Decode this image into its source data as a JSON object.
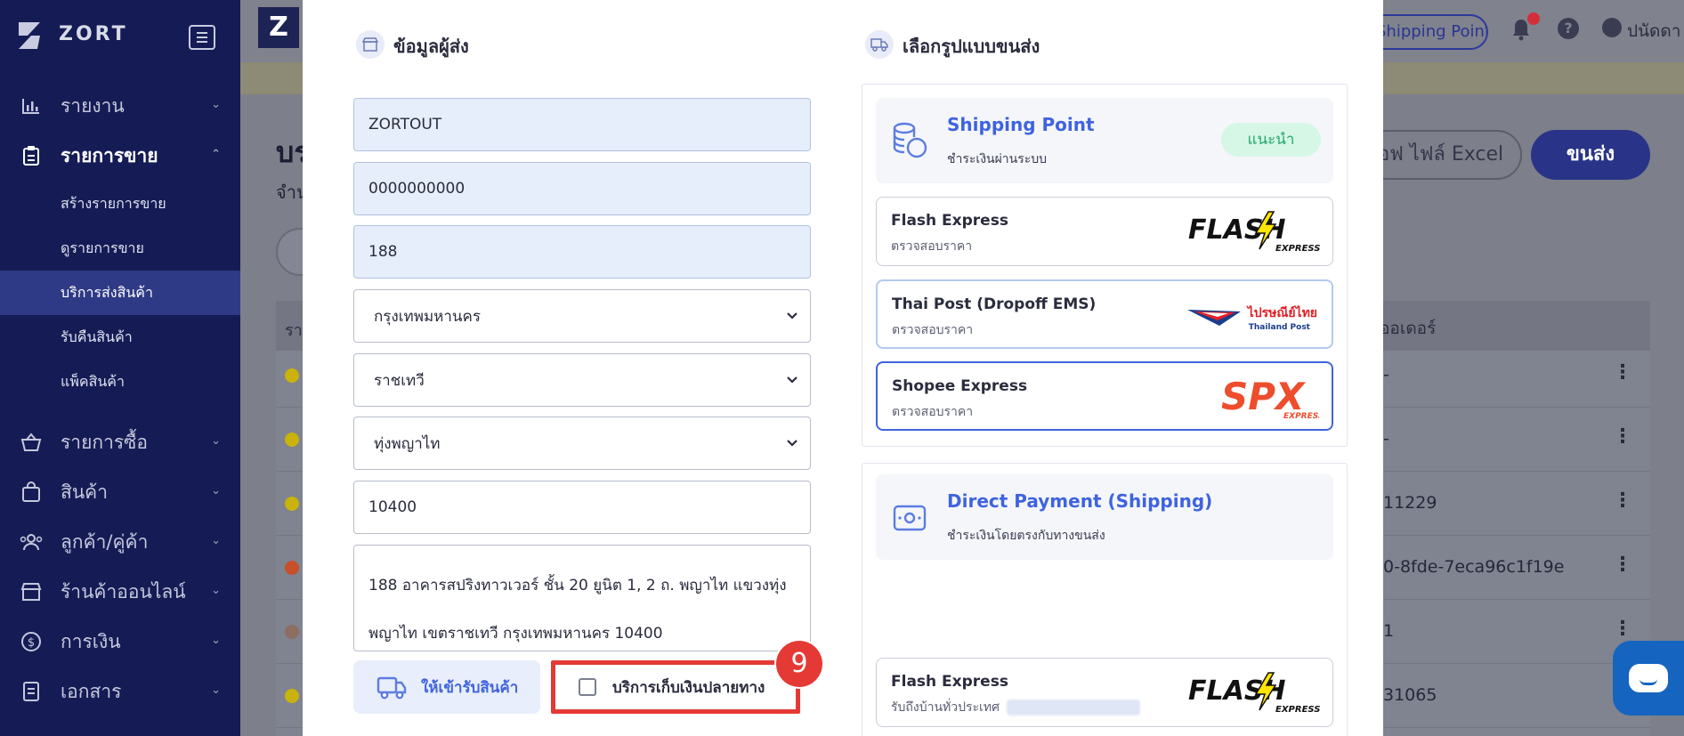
{
  "sidebar": {
    "brand": "ZORT",
    "items": [
      {
        "label": "รายงาน"
      },
      {
        "label": "รายการขาย"
      },
      {
        "label": "รายการซื้อ"
      },
      {
        "label": "สินค้า"
      },
      {
        "label": "ลูกค้า/คู่ค้า"
      },
      {
        "label": "ร้านค้าออนไลน์"
      },
      {
        "label": "การเงิน"
      },
      {
        "label": "เอกสาร"
      }
    ],
    "sales_sub": [
      {
        "label": "สร้างรายการขาย"
      },
      {
        "label": "ดูรายการขาย"
      },
      {
        "label": "บริการส่งสินค้า"
      },
      {
        "label": "รับคืนสินค้า"
      },
      {
        "label": "แพ็คสินค้า"
      }
    ]
  },
  "header": {
    "logo_letter": "Z",
    "shipping_point_pill": "Shipping Point",
    "user_name": "ปนัดดา"
  },
  "background_page": {
    "title": "บร",
    "subtitle": "จำน",
    "export_button": "อฟ ไฟล์ Excel",
    "ship_button": "ขนส่ง",
    "table_header_left": "รา",
    "table_header_right": "ออเดอร์",
    "rows": [
      {
        "value": "-",
        "dot_color": "#c9b30a"
      },
      {
        "value": "-",
        "dot_color": "#c9b30a"
      },
      {
        "value": "11229",
        "dot_color": "#c9b30a"
      },
      {
        "value": "0-8fde-7eca96c1f19e",
        "dot_color": "#c7502a"
      },
      {
        "value": "1",
        "dot_color": "#8d6e63"
      },
      {
        "value": "31065",
        "dot_color": "#c9b30a"
      }
    ]
  },
  "sender": {
    "section_title": "ข้อมูลผู้ส่ง",
    "name": "ZORTOUT",
    "phone": "0000000000",
    "house_no": "188",
    "province": "กรุงเทพมหานคร",
    "district": "ราชเทวี",
    "subdistrict": "ทุ่งพญาไท",
    "postcode": "10400",
    "address_line1": "188 อาคารสปริงทาวเวอร์ ชั้น 20 ยูนิต 1, 2 ถ. พญาไท แขวงทุ่ง",
    "address_line2": "พญาไท เขตราชเทวี กรุงเทพมหานคร 10400",
    "pickup_button": "ให้เข้ารับสินค้า",
    "cod_label": "บริการเก็บเงินปลายทาง",
    "step_number": "9"
  },
  "shipping": {
    "section_title": "เลือกรูปแบบขนส่ง",
    "shipping_point": {
      "title": "Shipping Point",
      "desc": "ชำระเงินผ่านระบบ",
      "badge": "แนะนำ",
      "carriers": [
        {
          "name": "Flash Express",
          "sub": "ตรวจสอบราคา",
          "logo": "flash-express-logo"
        },
        {
          "name": "Thai Post (Dropoff EMS)",
          "sub": "ตรวจสอบราคา",
          "logo": "thailand-post-logo",
          "logo_text": "ไปรษณีย์ไทย",
          "logo_sub": "Thailand Post"
        },
        {
          "name": "Shopee Express",
          "sub": "ตรวจสอบราคา",
          "logo": "spx-express-logo"
        }
      ]
    },
    "direct_payment": {
      "title": "Direct Payment (Shipping)",
      "desc": "ชำระเงินโดยตรงกับทางขนส่ง",
      "carriers": [
        {
          "name": "Flash Express",
          "sub": "รับถึงบ้านทั่วประเทศ",
          "logo": "flash-express-logo"
        }
      ]
    },
    "logo_text": {
      "flash": "FLASH",
      "flash_sub": "EXPRESS",
      "spx": "SPX",
      "spx_sub": "EXPRESS"
    }
  },
  "colors": {
    "sidebar_bg": "#151c55",
    "accent_blue": "#3f63e0",
    "recommend_green": "#22a866",
    "highlight_red": "#e53935"
  }
}
